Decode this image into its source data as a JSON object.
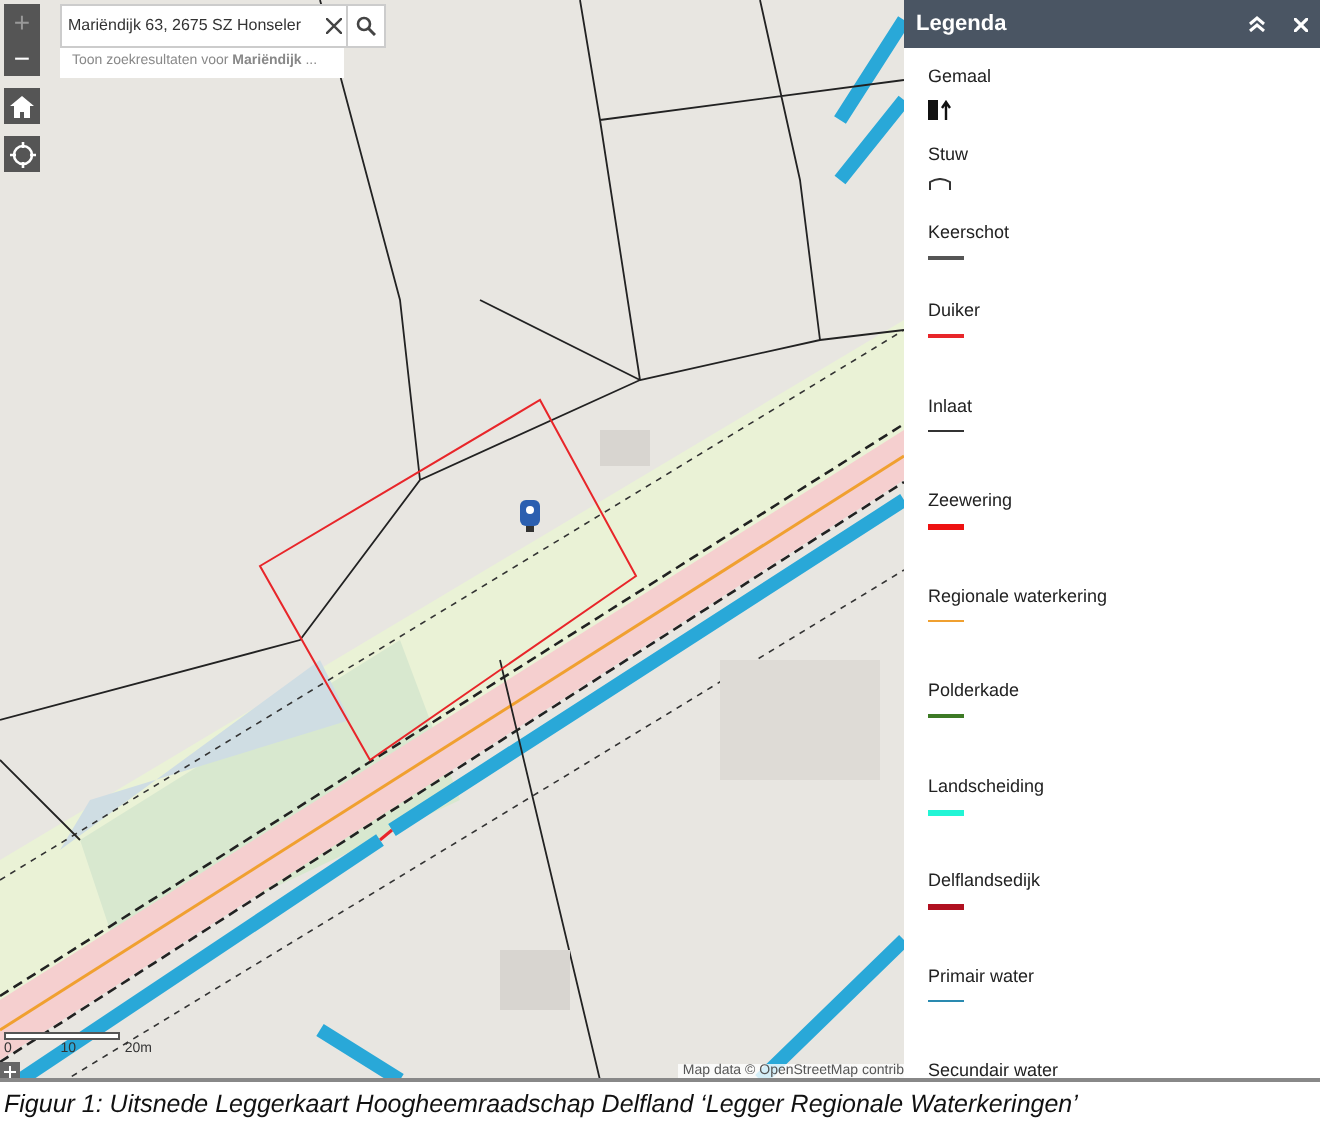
{
  "map_controls": {
    "zoom_in": {
      "label": "+",
      "disabled": true
    },
    "zoom_out": {
      "label": "−",
      "disabled": false
    }
  },
  "search": {
    "value": "Mariëndijk 63, 2675 SZ Honseler",
    "suggestion": "Toon zoekresultaten voor **Mariëndijk** ..."
  },
  "scale_bar": {
    "labels": [
      "0",
      "10",
      "20m"
    ]
  },
  "attribution": "Map data © OpenStreetMap contrib",
  "legend": {
    "title": "Legenda",
    "items": [
      {
        "label": "Gemaal",
        "kind": "pump"
      },
      {
        "label": "Stuw",
        "kind": "weir"
      },
      {
        "label": "Keerschot",
        "kind": "line",
        "color": "#555555"
      },
      {
        "label": "Duiker",
        "kind": "line",
        "color": "#e8262a"
      },
      {
        "label": "Inlaat",
        "kind": "line",
        "color": "#333333"
      },
      {
        "label": "Zeewering",
        "kind": "bar",
        "color": "#ee1111"
      },
      {
        "label": "Regionale waterkering",
        "kind": "line",
        "color": "#f0a030"
      },
      {
        "label": "Polderkade",
        "kind": "line",
        "color": "#3d7a25"
      },
      {
        "label": "Landscheiding",
        "kind": "bar",
        "color": "#22f5d5"
      },
      {
        "label": "Delflandsedijk",
        "kind": "bar",
        "color": "#b01020"
      },
      {
        "label": "Primair water",
        "kind": "line",
        "color": "#2a8ab0"
      },
      {
        "label": "Secundair water",
        "kind": "none"
      }
    ]
  },
  "caption": "Figuur 1: Uitsnede Leggerkaart Hoogheemraadschap Delfland ‘Legger Regionale Waterkeringen’"
}
